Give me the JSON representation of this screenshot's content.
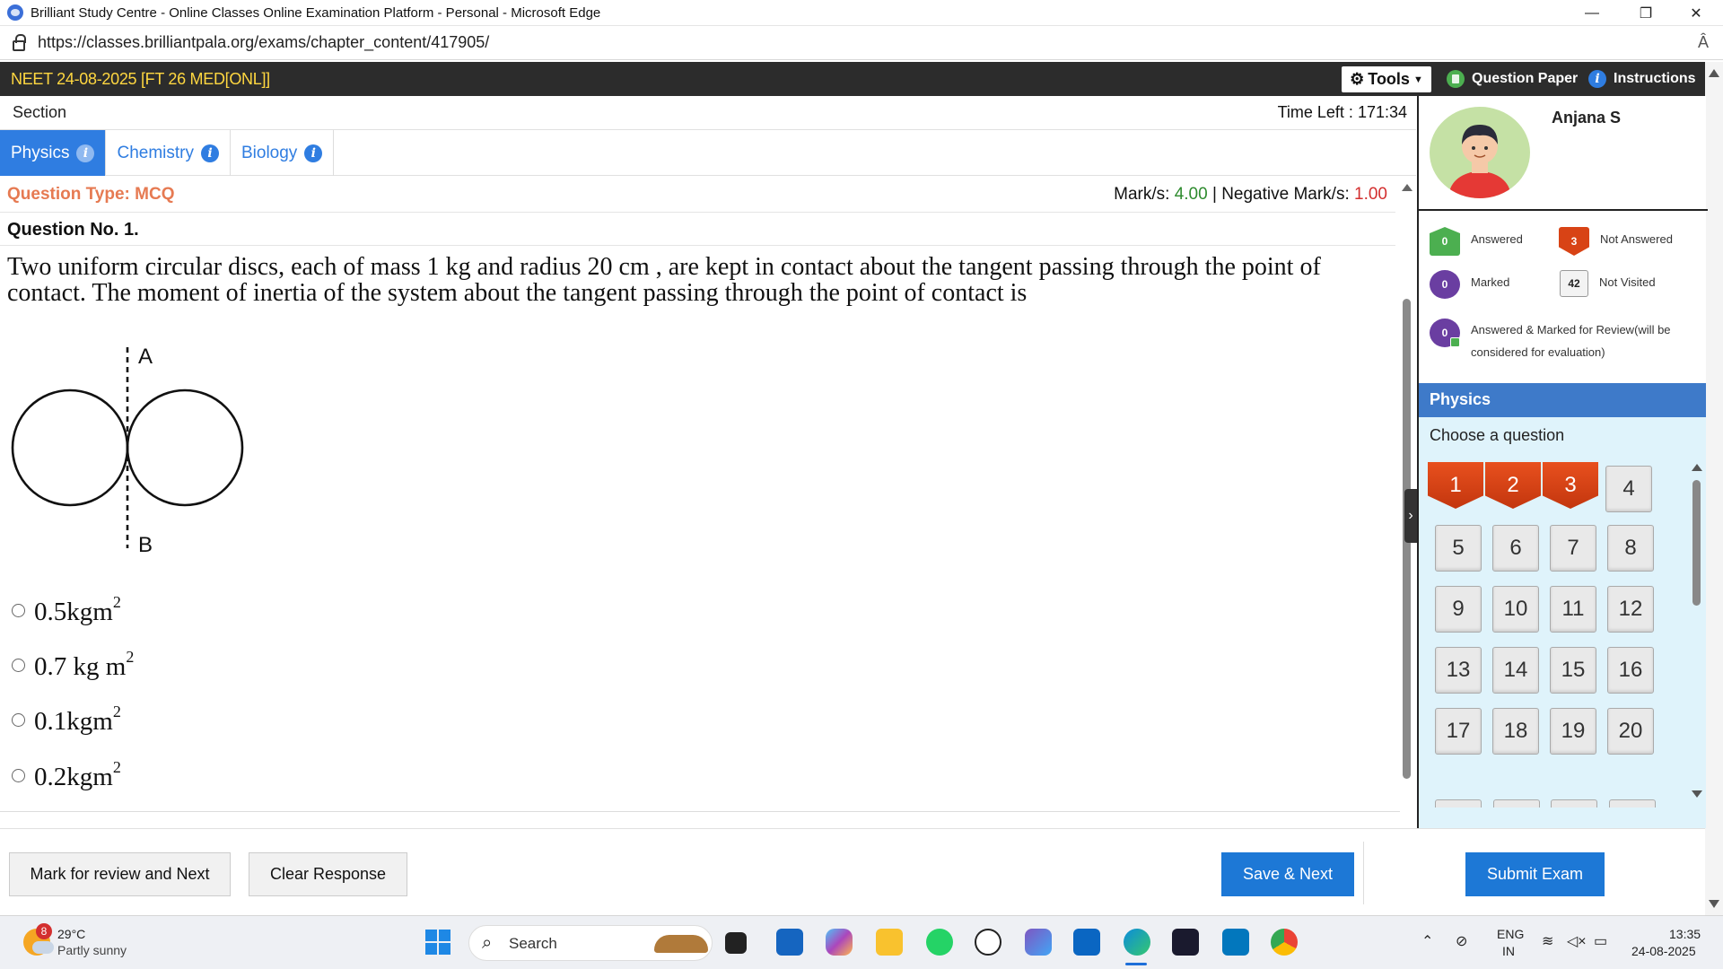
{
  "browser": {
    "window_title": "Brilliant Study Centre - Online Classes Online Examination Platform - Personal - Microsoft Edge",
    "url": "https://classes.brilliantpala.org/exams/chapter_content/417905/",
    "controls": {
      "minimize": "—",
      "restore": "❐",
      "close": "✕"
    },
    "read_aloud": "Â"
  },
  "exam": {
    "title": "NEET 24-08-2025 [FT 26 MED[ONL]]",
    "tools_label": "Tools",
    "question_paper_label": "Question Paper",
    "instructions_label": "Instructions"
  },
  "section": {
    "label": "Section",
    "time_left_label": "Time Left :",
    "time_left_value": "171:34",
    "tabs": [
      {
        "label": "Physics",
        "active": true
      },
      {
        "label": "Chemistry",
        "active": false
      },
      {
        "label": "Biology",
        "active": false
      }
    ]
  },
  "question": {
    "type_label": "Question Type: MCQ",
    "marks_label": "Mark/s:",
    "marks_value": "4.00",
    "separator": "|",
    "neg_marks_label": "Negative Mark/s:",
    "neg_marks_value": "1.00",
    "number_label": "Question No. 1.",
    "text": "Two uniform circular discs, each of mass 1 kg and radius 20 cm , are kept in contact about the tangent passing through the point of contact. The moment of inertia of the system about the tangent passing through the point of contact is",
    "diagram_labels": {
      "top": "A",
      "bottom": "B"
    },
    "options": [
      {
        "base": "0.5kgm",
        "sup": "2"
      },
      {
        "base": "0.7 kg m",
        "sup": "2"
      },
      {
        "base": "0.1kgm",
        "sup": "2"
      },
      {
        "base": "0.2kgm",
        "sup": "2"
      }
    ]
  },
  "actions": {
    "mark_review_next": "Mark for review and Next",
    "clear_response": "Clear Response",
    "save_next": "Save & Next",
    "submit_exam": "Submit Exam"
  },
  "user": {
    "name": "Anjana S"
  },
  "legend": {
    "answered": {
      "count": "0",
      "label": "Answered"
    },
    "not_answered": {
      "count": "3",
      "label": "Not Answered"
    },
    "marked": {
      "count": "0",
      "label": "Marked"
    },
    "not_visited": {
      "count": "42",
      "label": "Not Visited"
    },
    "answered_marked": {
      "count": "0",
      "label": "Answered & Marked for Review(will be considered for evaluation)"
    }
  },
  "palette": {
    "section_name": "Physics",
    "choose_label": "Choose a question",
    "questions": [
      {
        "n": "1",
        "status": "not_answered"
      },
      {
        "n": "2",
        "status": "not_answered"
      },
      {
        "n": "3",
        "status": "not_answered"
      },
      {
        "n": "4",
        "status": "not_visited"
      },
      {
        "n": "5",
        "status": "not_visited"
      },
      {
        "n": "6",
        "status": "not_visited"
      },
      {
        "n": "7",
        "status": "not_visited"
      },
      {
        "n": "8",
        "status": "not_visited"
      },
      {
        "n": "9",
        "status": "not_visited"
      },
      {
        "n": "10",
        "status": "not_visited"
      },
      {
        "n": "11",
        "status": "not_visited"
      },
      {
        "n": "12",
        "status": "not_visited"
      },
      {
        "n": "13",
        "status": "not_visited"
      },
      {
        "n": "14",
        "status": "not_visited"
      },
      {
        "n": "15",
        "status": "not_visited"
      },
      {
        "n": "16",
        "status": "not_visited"
      },
      {
        "n": "17",
        "status": "not_visited"
      },
      {
        "n": "18",
        "status": "not_visited"
      },
      {
        "n": "19",
        "status": "not_visited"
      },
      {
        "n": "20",
        "status": "not_visited"
      }
    ]
  },
  "taskbar": {
    "weather_badge": "8",
    "weather_temp": "29°C",
    "weather_desc": "Partly sunny",
    "search_label": "Search",
    "lang_top": "ENG",
    "lang_bottom": "IN",
    "time": "13:35",
    "date": "24-08-2025"
  },
  "colors": {
    "accent_blue": "#2f7de1",
    "button_blue": "#1d78d6",
    "qtype_orange": "#e67a52",
    "marks_green": "#2e8b2e",
    "neg_red": "#d32f2f",
    "header_dark": "#2c2c2c",
    "header_yellow": "#ffd740"
  }
}
